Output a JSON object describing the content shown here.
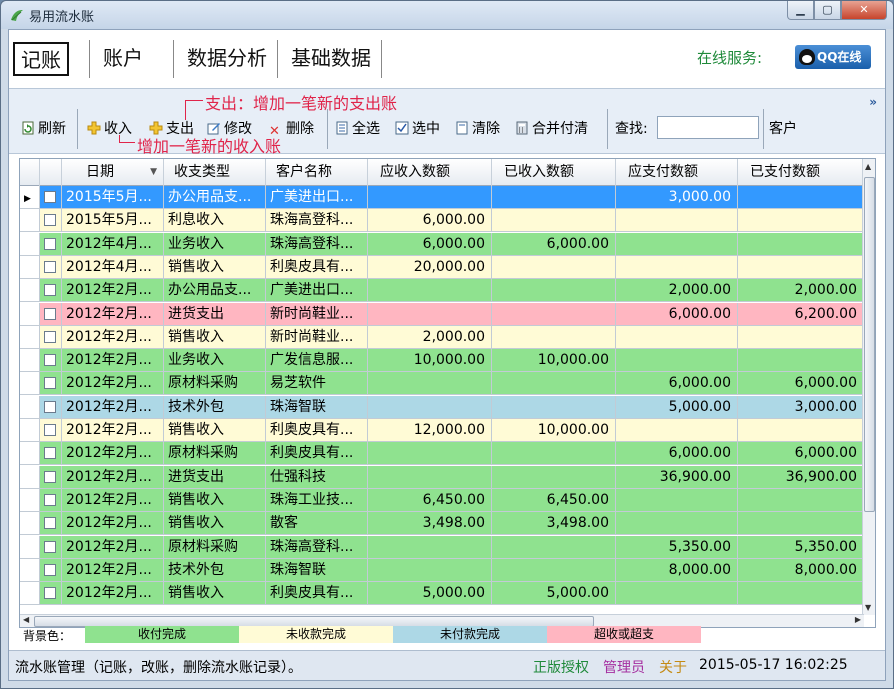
{
  "window": {
    "title": "易用流水账"
  },
  "menu": {
    "items": [
      "记账",
      "账户",
      "数据分析",
      "基础数据"
    ],
    "online_service": "在线服务:",
    "qq_button": "QQ在线"
  },
  "toolbar": {
    "refresh": "刷新",
    "income": "收入",
    "expense": "支出",
    "edit": "修改",
    "delete": "删除",
    "select_all": "全选",
    "selected": "选中",
    "clear": "清除",
    "merge_settle": "合并付清",
    "search_label": "查找:",
    "search_value": "",
    "customer_label": "客户",
    "annotation_expense": "支出：增加一笔新的支出账",
    "annotation_income": "增加一笔新的收入账"
  },
  "grid": {
    "columns": [
      "日期",
      "收支类型",
      "客户名称",
      "应收入数额",
      "已收入数额",
      "应支付数额",
      "已支付数额"
    ],
    "rows": [
      {
        "date": "2015年5月...",
        "type": "办公用品支...",
        "customer": "广美进出口...",
        "receivable": "",
        "received": "",
        "payable": "3,000.00",
        "paid": "",
        "status": "selected"
      },
      {
        "date": "2015年5月...",
        "type": "利息收入",
        "customer": "珠海高登科...",
        "receivable": "6,000.00",
        "received": "",
        "payable": "",
        "paid": "",
        "status": "pending_receive"
      },
      {
        "date": "2012年4月...",
        "type": "业务收入",
        "customer": "珠海高登科...",
        "receivable": "6,000.00",
        "received": "6,000.00",
        "payable": "",
        "paid": "",
        "status": "done"
      },
      {
        "date": "2012年4月...",
        "type": "销售收入",
        "customer": "利奥皮具有...",
        "receivable": "20,000.00",
        "received": "",
        "payable": "",
        "paid": "",
        "status": "pending_receive"
      },
      {
        "date": "2012年2月...",
        "type": "办公用品支...",
        "customer": "广美进出口...",
        "receivable": "",
        "received": "",
        "payable": "2,000.00",
        "paid": "2,000.00",
        "status": "done"
      },
      {
        "date": "2012年2月...",
        "type": "进货支出",
        "customer": "新时尚鞋业...",
        "receivable": "",
        "received": "",
        "payable": "6,000.00",
        "paid": "6,200.00",
        "status": "over"
      },
      {
        "date": "2012年2月...",
        "type": "销售收入",
        "customer": "新时尚鞋业...",
        "receivable": "2,000.00",
        "received": "",
        "payable": "",
        "paid": "",
        "status": "pending_receive"
      },
      {
        "date": "2012年2月...",
        "type": "业务收入",
        "customer": "广发信息服...",
        "receivable": "10,000.00",
        "received": "10,000.00",
        "payable": "",
        "paid": "",
        "status": "done"
      },
      {
        "date": "2012年2月...",
        "type": "原材料采购",
        "customer": "易芝软件",
        "receivable": "",
        "received": "",
        "payable": "6,000.00",
        "paid": "6,000.00",
        "status": "done"
      },
      {
        "date": "2012年2月...",
        "type": "技术外包",
        "customer": "珠海智联",
        "receivable": "",
        "received": "",
        "payable": "5,000.00",
        "paid": "3,000.00",
        "status": "pending_pay"
      },
      {
        "date": "2012年2月...",
        "type": "销售收入",
        "customer": "利奥皮具有...",
        "receivable": "12,000.00",
        "received": "10,000.00",
        "payable": "",
        "paid": "",
        "status": "pending_receive"
      },
      {
        "date": "2012年2月...",
        "type": "原材料采购",
        "customer": "利奥皮具有...",
        "receivable": "",
        "received": "",
        "payable": "6,000.00",
        "paid": "6,000.00",
        "status": "done"
      },
      {
        "date": "2012年2月...",
        "type": "进货支出",
        "customer": "仕强科技",
        "receivable": "",
        "received": "",
        "payable": "36,900.00",
        "paid": "36,900.00",
        "status": "done"
      },
      {
        "date": "2012年2月...",
        "type": "销售收入",
        "customer": "珠海工业技...",
        "receivable": "6,450.00",
        "received": "6,450.00",
        "payable": "",
        "paid": "",
        "status": "done"
      },
      {
        "date": "2012年2月...",
        "type": "销售收入",
        "customer": "散客",
        "receivable": "3,498.00",
        "received": "3,498.00",
        "payable": "",
        "paid": "",
        "status": "done"
      },
      {
        "date": "2012年2月...",
        "type": "原材料采购",
        "customer": "珠海高登科...",
        "receivable": "",
        "received": "",
        "payable": "5,350.00",
        "paid": "5,350.00",
        "status": "done"
      },
      {
        "date": "2012年2月...",
        "type": "技术外包",
        "customer": "珠海智联",
        "receivable": "",
        "received": "",
        "payable": "8,000.00",
        "paid": "8,000.00",
        "status": "done"
      },
      {
        "date": "2012年2月...",
        "type": "销售收入",
        "customer": "利奥皮具有...",
        "receivable": "5,000.00",
        "received": "5,000.00",
        "payable": "",
        "paid": "",
        "status": "done"
      }
    ]
  },
  "legend": {
    "label": "背景色：",
    "items": [
      {
        "text": "收付完成",
        "color": "#8fe28f"
      },
      {
        "text": "未收款完成",
        "color": "#fffbd6"
      },
      {
        "text": "未付款完成",
        "color": "#add8e6"
      },
      {
        "text": "超收或超支",
        "color": "#ffb6c1"
      }
    ]
  },
  "status": {
    "description": "流水账管理（记账，改账，删除流水账记录）。",
    "auth": "正版授权",
    "user": "管理员",
    "about": "关于",
    "datetime": "2015-05-17 16:02:25"
  },
  "colors": {
    "done": "#8fe28f",
    "pending_receive": "#fffbd6",
    "pending_pay": "#add8e6",
    "over": "#ffb6c1",
    "selected": "#3399ff"
  }
}
